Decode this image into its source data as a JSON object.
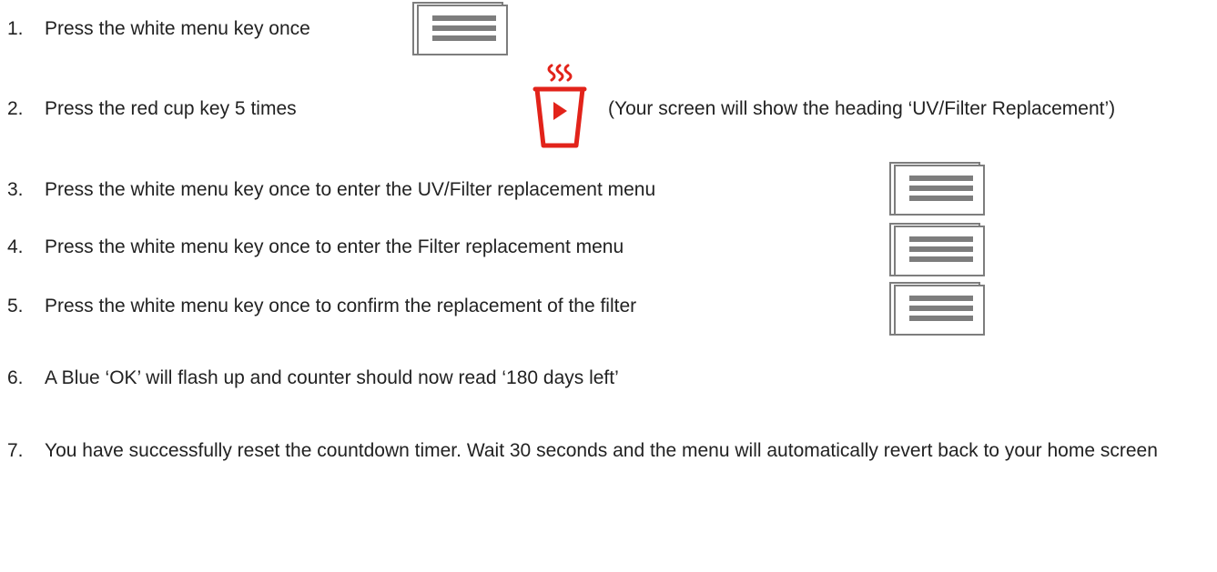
{
  "steps": [
    {
      "num": "1.",
      "text": "Press the white menu key once"
    },
    {
      "num": "2.",
      "text": "Press the red cup key 5 times"
    },
    {
      "num": "3.",
      "text": "Press the white menu key once to enter the UV/Filter replacement menu"
    },
    {
      "num": "4.",
      "text": "Press the white menu key once to enter the Filter replacement menu"
    },
    {
      "num": "5.",
      "text": "Press the white menu key once to confirm the replacement of the filter"
    },
    {
      "num": "6.",
      "text": "A Blue ‘OK’ will flash up and counter should now read ‘180 days left’"
    },
    {
      "num": "7.",
      "text": "You have successfully reset the countdown timer. Wait 30 seconds and the menu will automatically revert back to your home screen"
    }
  ],
  "step2_note": "(Your screen will show the heading ‘UV/Filter Replacement’)",
  "icons": {
    "menu_key": "menu-key-icon",
    "cup_key": "red-cup-key-icon"
  },
  "colors": {
    "text": "#222222",
    "menu_key_gray": "#7d7d7d",
    "cup_red": "#e2231a"
  }
}
